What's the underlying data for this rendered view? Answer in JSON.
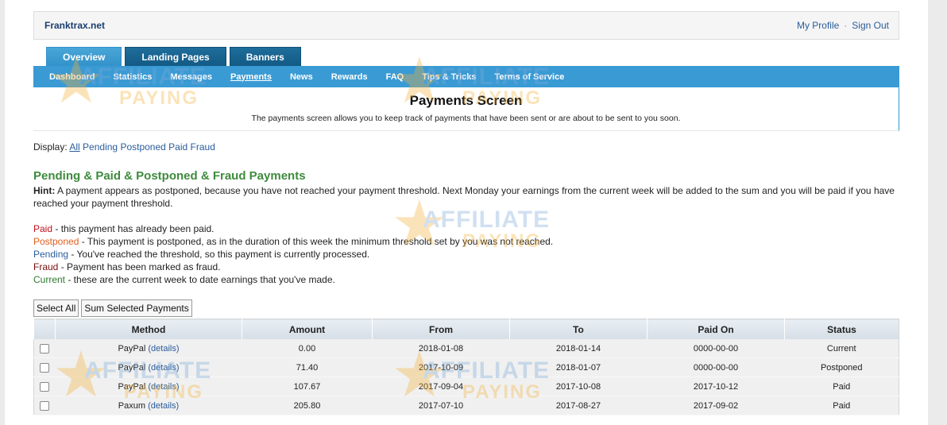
{
  "header": {
    "site_name": "Franktrax.net",
    "links": [
      "My Profile",
      "Sign Out"
    ],
    "separator": "·"
  },
  "tabs": [
    "Overview",
    "Landing Pages",
    "Banners"
  ],
  "active_tab": "Overview",
  "subnav": [
    "Dashboard",
    "Statistics",
    "Messages",
    "Payments",
    "News",
    "Rewards",
    "FAQ",
    "Tips & Tricks",
    "Terms of Service"
  ],
  "active_subnav": "Payments",
  "page_title": "Payments Screen",
  "page_description": "The payments screen allows you to keep track of payments that have been sent or are about to be sent to you soon.",
  "display": {
    "label": "Display:",
    "options": [
      "All",
      "Pending",
      "Postponed",
      "Paid",
      "Fraud"
    ]
  },
  "section_title": "Pending & Paid & Postponed & Fraud Payments",
  "hint": {
    "label": "Hint:",
    "text": "A payment appears as postponed, because you have not reached your payment threshold. Next Monday your earnings from the current week will be added to the sum and you will be paid if you have reached your payment threshold."
  },
  "legend": [
    {
      "term": "Paid",
      "desc": " - this payment has already been paid.",
      "color": "#c0111a"
    },
    {
      "term": "Postponed",
      "desc": " - This payment is postponed, as in the duration of this week the minimum threshold set by you was not reached.",
      "color": "#e35d1c"
    },
    {
      "term": "Pending",
      "desc": " - You've reached the threshold, so this payment is currently processed.",
      "color": "#2a5d9c"
    },
    {
      "term": "Fraud",
      "desc": " - Payment has been marked as fraud.",
      "color": "#7a1010"
    },
    {
      "term": "Current",
      "desc": " - these are the current week to date earnings that you've made.",
      "color": "#2d7a2d"
    }
  ],
  "buttons": {
    "select_all": "Select All",
    "sum_selected": "Sum Selected Payments"
  },
  "table": {
    "columns": [
      "Method",
      "Amount",
      "From",
      "To",
      "Paid On",
      "Status"
    ],
    "details_label": "(details)",
    "rows": [
      {
        "method": "PayPal",
        "amount": "0.00",
        "from": "2018-01-08",
        "to": "2018-01-14",
        "paid_on": "0000-00-00",
        "status": "Current"
      },
      {
        "method": "PayPal",
        "amount": "71.40",
        "from": "2017-10-09",
        "to": "2018-01-07",
        "paid_on": "0000-00-00",
        "status": "Postponed"
      },
      {
        "method": "PayPal",
        "amount": "107.67",
        "from": "2017-09-04",
        "to": "2017-10-08",
        "paid_on": "2017-10-12",
        "status": "Paid"
      },
      {
        "method": "Paxum",
        "amount": "205.80",
        "from": "2017-07-10",
        "to": "2017-08-27",
        "paid_on": "2017-09-02",
        "status": "Paid"
      }
    ]
  },
  "watermark": {
    "line1": "AFFILIATE",
    "line2": "PAYING"
  },
  "colors": {
    "accent": "#3a9ad4",
    "tab_dark": "#135a85",
    "section_green": "#3d8b3d",
    "link": "#2a5d9c"
  }
}
